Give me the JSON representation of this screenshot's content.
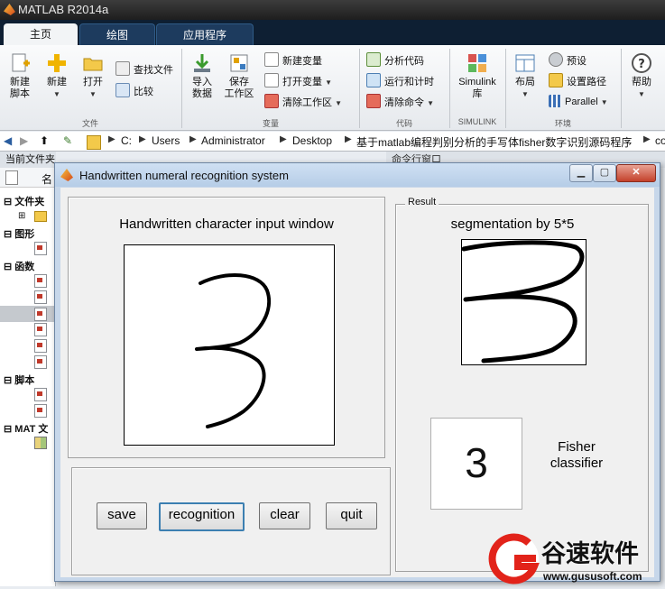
{
  "app": {
    "title": "MATLAB R2014a"
  },
  "tabs": [
    {
      "label": "主页",
      "active": true
    },
    {
      "label": "绘图",
      "active": false
    },
    {
      "label": "应用程序",
      "active": false
    }
  ],
  "ribbon": {
    "file": {
      "new_script": [
        "新建",
        "脚本"
      ],
      "new": "新建",
      "open": "打开",
      "find_files": "查找文件",
      "compare": "比较",
      "label": "文件"
    },
    "variable": {
      "import": [
        "导入",
        "数据"
      ],
      "save_ws": [
        "保存",
        "工作区"
      ],
      "new_var": "新建变量",
      "open_var": "打开变量",
      "clear_ws": "清除工作区",
      "label": "变量"
    },
    "code": {
      "analyze": "分析代码",
      "run_time": "运行和计时",
      "clear_cmd": "清除命令",
      "label": "代码"
    },
    "simulink": {
      "button": [
        "Simulink",
        "库"
      ],
      "label": "SIMULINK"
    },
    "env": {
      "layout": "布局",
      "prefs": "预设",
      "set_path": "设置路径",
      "parallel": "Parallel",
      "label": "环境"
    },
    "resources": {
      "help": "帮助"
    }
  },
  "address": {
    "crumbs": [
      "C:",
      "Users",
      "Administrator",
      "Desktop",
      "基于matlab编程判别分析的手写体fisher数字识别源码程序",
      "co"
    ]
  },
  "current_folder": {
    "header": "当前文件夹",
    "col_name": "名",
    "sections": [
      "文件夹",
      "图形",
      "函数",
      "脚本",
      "MAT 文"
    ]
  },
  "command_window": {
    "header": "命令行窗口"
  },
  "figure": {
    "title": "Handwritten numeral recognition system",
    "input_label": "Handwritten character input window",
    "result_title": "Result",
    "segmentation_label": "segmentation by 5*5",
    "recognized_digit": "3",
    "classifier_label": [
      "Fisher",
      "classifier"
    ],
    "buttons": {
      "save": "save",
      "recognition": "recognition",
      "clear": "clear",
      "quit": "quit"
    }
  },
  "watermark": {
    "name": "谷速软件",
    "url": "www.gususoft.com"
  },
  "colors": {
    "tab_dark": "#0e1f33",
    "figure_frame": "#c7d7ea",
    "focus_border": "#3c7fb1",
    "watermark_red": "#e2231a"
  }
}
